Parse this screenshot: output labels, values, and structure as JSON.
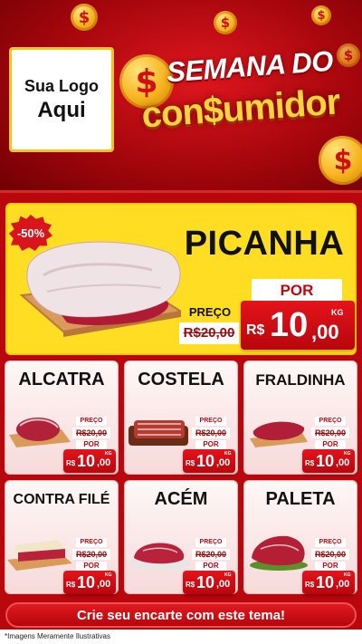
{
  "logo": {
    "line1": "Sua Logo",
    "line2": "Aqui"
  },
  "headline": {
    "line1": "SEMANA DO",
    "line2": "con$umidor"
  },
  "feature": {
    "discount": "-50%",
    "name": "PICANHA",
    "preco_label": "PREÇO",
    "old_price": "R$20,00",
    "por_label": "POR",
    "currency": "R$",
    "price_int": "10",
    "price_dec": ",00",
    "unit": "KG"
  },
  "products": [
    {
      "name": "ALCATRA",
      "preco_label": "PREÇO",
      "old_price": "R$20,00",
      "por_label": "POR",
      "currency": "R$",
      "price_int": "10",
      "price_dec": ",00",
      "unit": "KG"
    },
    {
      "name": "COSTELA",
      "preco_label": "PREÇO",
      "old_price": "R$20,00",
      "por_label": "POR",
      "currency": "R$",
      "price_int": "10",
      "price_dec": ",00",
      "unit": "KG"
    },
    {
      "name": "FRALDINHA",
      "preco_label": "PREÇO",
      "old_price": "R$20,00",
      "por_label": "POR",
      "currency": "R$",
      "price_int": "10",
      "price_dec": ",00",
      "unit": "KG"
    },
    {
      "name": "CONTRA FILÉ",
      "preco_label": "PREÇO",
      "old_price": "R$20,00",
      "por_label": "POR",
      "currency": "R$",
      "price_int": "10",
      "price_dec": ",00",
      "unit": "KG"
    },
    {
      "name": "ACÉM",
      "preco_label": "PREÇO",
      "old_price": "R$20,00",
      "por_label": "POR",
      "currency": "R$",
      "price_int": "10",
      "price_dec": ",00",
      "unit": "KG"
    },
    {
      "name": "PALETA",
      "preco_label": "PREÇO",
      "old_price": "R$20,00",
      "por_label": "POR",
      "currency": "R$",
      "price_int": "10",
      "price_dec": ",00",
      "unit": "KG"
    }
  ],
  "cta": "Crie seu encarte com este tema!",
  "footnote": "*Imagens Meramente Ilustrativas",
  "coin_symbol": "$",
  "colors": {
    "brand_red": "#c4060d",
    "accent_yellow": "#ffdd22",
    "coin_gold": "#f6b21b"
  }
}
